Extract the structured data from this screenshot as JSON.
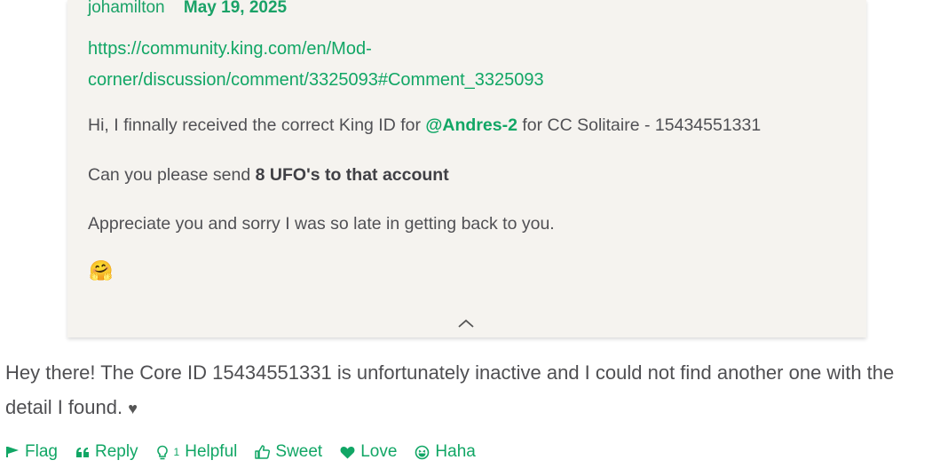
{
  "quote": {
    "author": "johamilton",
    "date": "May 19, 2025",
    "link_line1": "https://community.king.com/en/Mod-",
    "link_line2": "corner/discussion/comment/3325093#Comment_3325093",
    "p1_before": "Hi, I finnally received the correct King ID for ",
    "p1_mention": "@Andres-2",
    "p1_after": " for CC Solitaire - 15434551331",
    "p2_before": "Can you please send ",
    "p2_bold": "8 UFO's to that account",
    "p3": "Appreciate you and sorry I was so late in getting back to you.",
    "emoji": "🤗"
  },
  "reply": {
    "text": "Hey there! The Core ID 15434551331 is unfortunately inactive and I could not find another one with the detail I found.",
    "heart": "♥"
  },
  "actions": {
    "flag": "Flag",
    "reply": "Reply",
    "helpful_count": "1",
    "helpful": "Helpful",
    "sweet": "Sweet",
    "love": "Love",
    "haha": "Haha"
  },
  "colors": {
    "accent": "#11a665",
    "quote_bg": "#f5f3ef",
    "text": "#4f4f52"
  }
}
